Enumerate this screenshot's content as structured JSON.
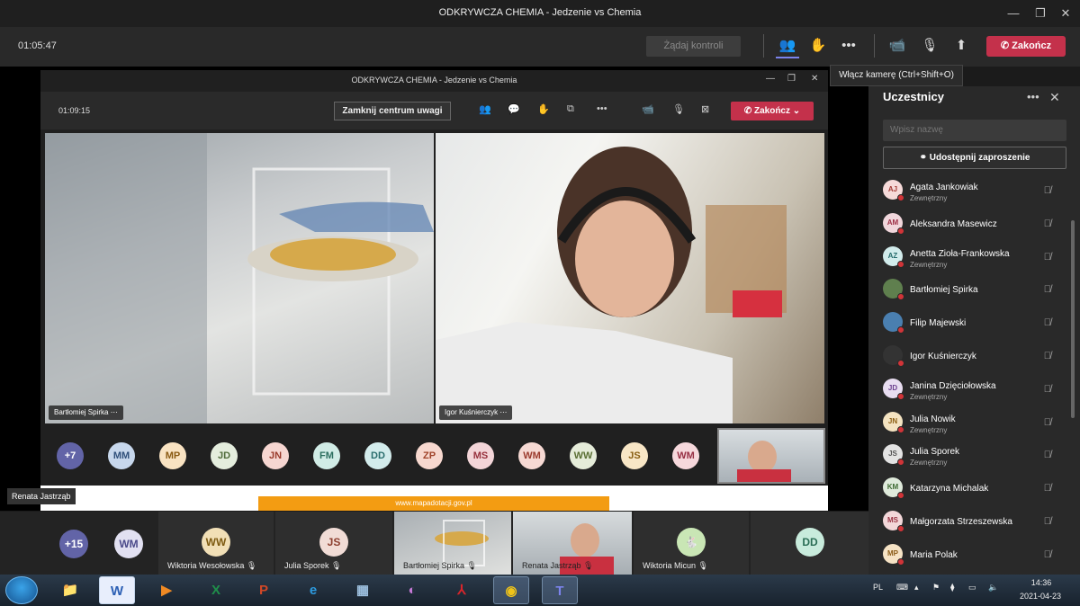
{
  "window": {
    "title": "ODKRYWCZA CHEMIA - Jedzenie vs Chemia"
  },
  "toolbar": {
    "timer": "01:05:47",
    "request_control": "Żądaj kontroli",
    "end_label": "Zakończ",
    "tooltip": "Włącz kamerę (Ctrl+Shift+O)"
  },
  "shared": {
    "title": "ODKRYWCZA CHEMIA - Jedzenie vs Chemia",
    "timer": "01:09:15",
    "spotlight_label": "Zamknij centrum uwagi",
    "end_label": "Zakończ",
    "video1_name": "Bartłomiej Spirka",
    "video2_name": "Igor Kuśnierczyk",
    "avatars": [
      {
        "initials": "+7",
        "color": "#6264a7",
        "fg": "#ffffff"
      },
      {
        "initials": "MM",
        "color": "#c7d7ec",
        "fg": "#2f4f7a"
      },
      {
        "initials": "MP",
        "color": "#f9e3c2",
        "fg": "#8a5a12"
      },
      {
        "initials": "JD",
        "color": "#e4eddd",
        "fg": "#4f6b3a"
      },
      {
        "initials": "JN",
        "color": "#f6d6d1",
        "fg": "#9a3a2b"
      },
      {
        "initials": "FM",
        "color": "#d1ece6",
        "fg": "#2b6e5e"
      },
      {
        "initials": "DD",
        "color": "#d3ecec",
        "fg": "#296d6d"
      },
      {
        "initials": "ZP",
        "color": "#f7d8cf",
        "fg": "#a0432a"
      },
      {
        "initials": "MS",
        "color": "#f3d5d8",
        "fg": "#97313d"
      },
      {
        "initials": "WM",
        "color": "#f6d9d3",
        "fg": "#9b3a2d"
      },
      {
        "initials": "WW",
        "color": "#e5ecd9",
        "fg": "#5a6f34"
      },
      {
        "initials": "JS",
        "color": "#f8e6c6",
        "fg": "#8a5f13"
      },
      {
        "initials": "WM",
        "color": "#f6d8dc",
        "fg": "#972f44"
      }
    ],
    "web_link": "www.mapadotacji.gov.pl"
  },
  "presenter_tag": "Renata Jastrząb",
  "bottom": {
    "tiles": [
      {
        "initials": "+15",
        "color": "#6264a7",
        "fg": "#ffffff"
      },
      {
        "initials": "WM",
        "color": "#e1e0f1",
        "fg": "#4b4a8a"
      }
    ],
    "named": [
      {
        "initials": "WW",
        "name": "Wiktoria Wesołowska",
        "color": "#f1dfb6",
        "fg": "#7d5a10"
      },
      {
        "initials": "JS",
        "name": "Julia Sporek",
        "color": "#f1dcd6",
        "fg": "#8c3e2e"
      },
      {
        "initials": "",
        "name": "Bartłomiej Spirka",
        "color": "",
        "fg": ""
      },
      {
        "initials": "",
        "name": "Renata Jastrząb",
        "color": "",
        "fg": ""
      },
      {
        "initials": "",
        "name": "Wiktoria Micun",
        "color": "#c9e6b5",
        "fg": "#3b6a1f"
      },
      {
        "initials": "DD",
        "name": "",
        "color": "#c8ebdc",
        "fg": "#2a6d55"
      }
    ]
  },
  "panel": {
    "title": "Uczestnicy",
    "search_placeholder": "Wpisz nazwę",
    "share_label": "Udostępnij zaproszenie",
    "participants": [
      {
        "initials": "AJ",
        "name": "Agata Jankowiak",
        "sub": "Zewnętrzny",
        "color": "#f6dad9",
        "fg": "#a33b35"
      },
      {
        "initials": "AM",
        "name": "Aleksandra Masewicz",
        "sub": "",
        "color": "#f1d7dc",
        "fg": "#9d2f45"
      },
      {
        "initials": "AZ",
        "name": "Anetta Zioła-Frankowska",
        "sub": "Zewnętrzny",
        "color": "#d2ecec",
        "fg": "#246b6b"
      },
      {
        "initials": "",
        "name": "Bartłomiej Spirka",
        "sub": "",
        "color": "#5f7f4e",
        "fg": "#ffffff"
      },
      {
        "initials": "",
        "name": "Filip Majewski",
        "sub": "",
        "color": "#4a7fb0",
        "fg": "#ffffff"
      },
      {
        "initials": "",
        "name": "Igor Kuśnierczyk",
        "sub": "",
        "color": "#333333",
        "fg": "#ffffff"
      },
      {
        "initials": "JD",
        "name": "Janina Dzięciołowska",
        "sub": "Zewnętrzny",
        "color": "#e8ddf1",
        "fg": "#6b3f8f"
      },
      {
        "initials": "JN",
        "name": "Julia Nowik",
        "sub": "Zewnętrzny",
        "color": "#f4e3c1",
        "fg": "#8b5d11"
      },
      {
        "initials": "JS",
        "name": "Julia Sporek",
        "sub": "Zewnętrzny",
        "color": "#e3e3e3",
        "fg": "#555555"
      },
      {
        "initials": "KM",
        "name": "Katarzyna Michalak",
        "sub": "",
        "color": "#dfeadb",
        "fg": "#3f6b33"
      },
      {
        "initials": "MS",
        "name": "Małgorzata Strzeszewska",
        "sub": "",
        "color": "#f3d7d9",
        "fg": "#983343"
      },
      {
        "initials": "MP",
        "name": "Maria Polak",
        "sub": "",
        "color": "#f6e3c5",
        "fg": "#8a5a15"
      }
    ]
  },
  "taskbar": {
    "lang": "PL",
    "time": "14:36",
    "date": "2021-04-23"
  }
}
